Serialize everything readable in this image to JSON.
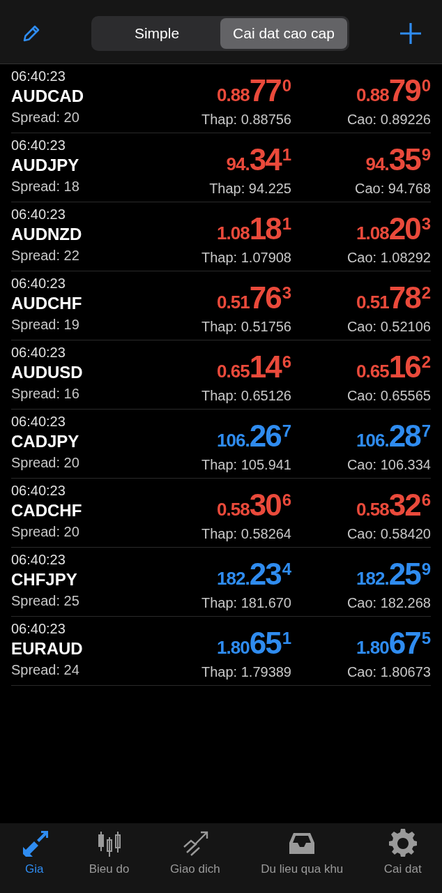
{
  "header": {
    "segments": [
      {
        "label": "Simple",
        "selected": false
      },
      {
        "label": "Cai dat cao cap",
        "selected": true
      }
    ]
  },
  "quotes": [
    {
      "time": "06:40:23",
      "symbol": "AUDCAD",
      "spread": "Spread: 20",
      "color": "#ea4a3b",
      "bid": {
        "prefix": "0.88",
        "big": "77",
        "sup": "0"
      },
      "ask": {
        "prefix": "0.88",
        "big": "79",
        "sup": "0"
      },
      "low": "Thap: 0.88756",
      "high": "Cao: 0.89226"
    },
    {
      "time": "06:40:23",
      "symbol": "AUDJPY",
      "spread": "Spread: 18",
      "color": "#ea4a3b",
      "bid": {
        "prefix": "94.",
        "big": "34",
        "sup": "1"
      },
      "ask": {
        "prefix": "94.",
        "big": "35",
        "sup": "9"
      },
      "low": "Thap: 94.225",
      "high": "Cao: 94.768"
    },
    {
      "time": "06:40:23",
      "symbol": "AUDNZD",
      "spread": "Spread: 22",
      "color": "#ea4a3b",
      "bid": {
        "prefix": "1.08",
        "big": "18",
        "sup": "1"
      },
      "ask": {
        "prefix": "1.08",
        "big": "20",
        "sup": "3"
      },
      "low": "Thap: 1.07908",
      "high": "Cao: 1.08292"
    },
    {
      "time": "06:40:23",
      "symbol": "AUDCHF",
      "spread": "Spread: 19",
      "color": "#ea4a3b",
      "bid": {
        "prefix": "0.51",
        "big": "76",
        "sup": "3"
      },
      "ask": {
        "prefix": "0.51",
        "big": "78",
        "sup": "2"
      },
      "low": "Thap: 0.51756",
      "high": "Cao: 0.52106"
    },
    {
      "time": "06:40:23",
      "symbol": "AUDUSD",
      "spread": "Spread: 16",
      "color": "#ea4a3b",
      "bid": {
        "prefix": "0.65",
        "big": "14",
        "sup": "6"
      },
      "ask": {
        "prefix": "0.65",
        "big": "16",
        "sup": "2"
      },
      "low": "Thap: 0.65126",
      "high": "Cao: 0.65565"
    },
    {
      "time": "06:40:23",
      "symbol": "CADJPY",
      "spread": "Spread: 20",
      "color": "#2f8cf0",
      "bid": {
        "prefix": "106.",
        "big": "26",
        "sup": "7"
      },
      "ask": {
        "prefix": "106.",
        "big": "28",
        "sup": "7"
      },
      "low": "Thap: 105.941",
      "high": "Cao: 106.334"
    },
    {
      "time": "06:40:23",
      "symbol": "CADCHF",
      "spread": "Spread: 20",
      "color": "#ea4a3b",
      "bid": {
        "prefix": "0.58",
        "big": "30",
        "sup": "6"
      },
      "ask": {
        "prefix": "0.58",
        "big": "32",
        "sup": "6"
      },
      "low": "Thap: 0.58264",
      "high": "Cao: 0.58420"
    },
    {
      "time": "06:40:23",
      "symbol": "CHFJPY",
      "spread": "Spread: 25",
      "color": "#2f8cf0",
      "bid": {
        "prefix": "182.",
        "big": "23",
        "sup": "4"
      },
      "ask": {
        "prefix": "182.",
        "big": "25",
        "sup": "9"
      },
      "low": "Thap: 181.670",
      "high": "Cao: 182.268"
    },
    {
      "time": "06:40:23",
      "symbol": "EURAUD",
      "spread": "Spread: 24",
      "color": "#2f8cf0",
      "bid": {
        "prefix": "1.80",
        "big": "65",
        "sup": "1"
      },
      "ask": {
        "prefix": "1.80",
        "big": "67",
        "sup": "5"
      },
      "low": "Thap: 1.79389",
      "high": "Cao: 1.80673"
    }
  ],
  "tab_bar": [
    {
      "kind": "quotes",
      "label": "Gia",
      "selected": true
    },
    {
      "kind": "chart",
      "label": "Bieu do",
      "selected": false
    },
    {
      "kind": "trade",
      "label": "Giao dich",
      "selected": false
    },
    {
      "kind": "history",
      "label": "Du lieu qua khu",
      "selected": false
    },
    {
      "kind": "settings",
      "label": "Cai dat",
      "selected": false
    }
  ]
}
